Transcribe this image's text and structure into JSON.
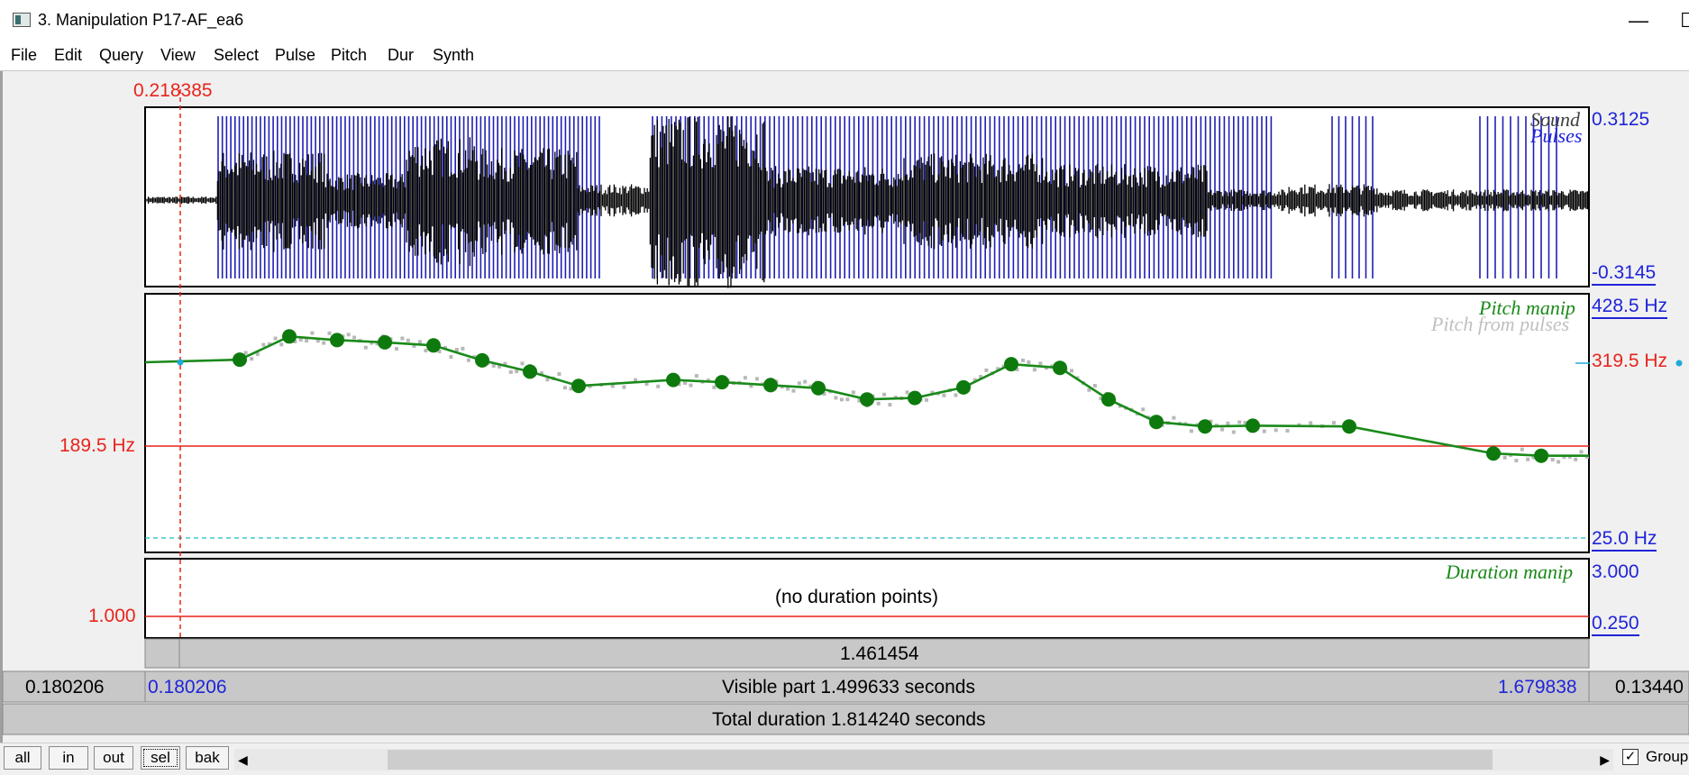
{
  "window": {
    "title": "3. Manipulation P17-AF_ea6",
    "minimize_glyph": "—",
    "maximize_glyph": "☐"
  },
  "menu": [
    "File",
    "Edit",
    "Query",
    "View",
    "Select",
    "Pulse",
    "Pitch",
    "Dur",
    "Synth"
  ],
  "cursor_time": "0.218385",
  "sound_panel": {
    "title_sound": "Sound",
    "title_pulses": "Pulses",
    "max": "0.3125",
    "min": "-0.3145"
  },
  "pitch_panel": {
    "title_manip": "Pitch manip",
    "title_pulses": "Pitch from pulses",
    "top": "428.5 Hz",
    "cursor_value": "319.5 Hz",
    "ref_value": "189.5 Hz",
    "bottom": "25.0 Hz",
    "manip_points_hz": [
      319.5,
      323,
      354,
      349,
      346,
      342,
      322,
      307,
      288,
      296,
      293,
      289,
      285,
      270,
      272,
      286,
      317,
      312,
      270,
      240,
      234,
      235,
      234,
      198,
      195
    ]
  },
  "duration_panel": {
    "title": "Duration manip",
    "top": "3.000",
    "bottom": "0.250",
    "ref_value": "1.000",
    "empty_text": "(no duration points)"
  },
  "time_bars": {
    "selection_right_length": "1.461454",
    "left_outside": "0.180206",
    "visible_start": "0.180206",
    "visible_part": "Visible part 1.499633 seconds",
    "visible_end": "1.679838",
    "right_outside": "0.13440",
    "total_duration": "Total duration 1.814240 seconds"
  },
  "buttons": {
    "all": "all",
    "in": "in",
    "out": "out",
    "sel": "sel",
    "bak": "bak"
  },
  "group": {
    "label": "Group",
    "checked": true
  },
  "colors": {
    "accent_red": "#e8241c",
    "axis_blue": "#1f24d8",
    "pitch_green": "#1a8a1a",
    "pulses_blue": "#1f1fb4",
    "waveform": "#000000"
  }
}
